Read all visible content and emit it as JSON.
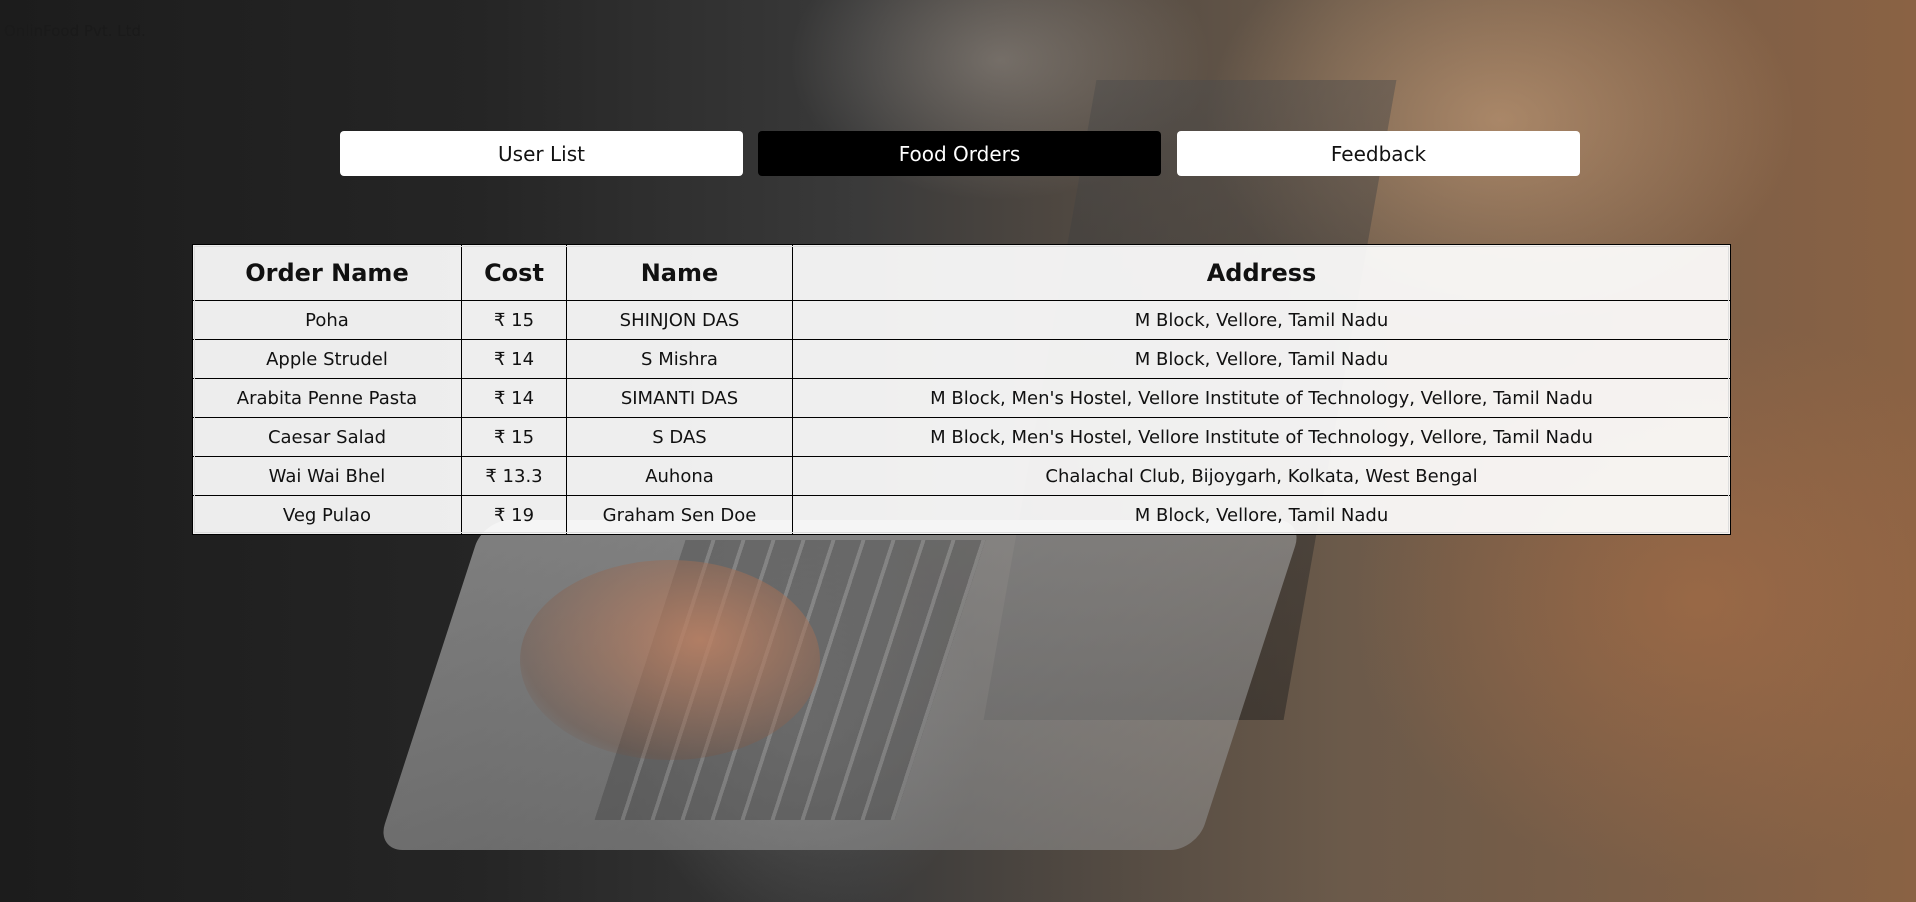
{
  "company": "OnlinFood Pvt. Ltd.",
  "tabs": [
    {
      "label": "User List",
      "active": false
    },
    {
      "label": "Food Orders",
      "active": true
    },
    {
      "label": "Feedback",
      "active": false
    }
  ],
  "table": {
    "headers": [
      "Order Name",
      "Cost",
      "Name",
      "Address"
    ],
    "rows": [
      [
        "Poha",
        "₹ 15",
        "SHINJON DAS",
        "M Block, Vellore, Tamil Nadu"
      ],
      [
        "Apple Strudel",
        "₹ 14",
        "S Mishra",
        "M Block, Vellore, Tamil Nadu"
      ],
      [
        "Arabita Penne Pasta",
        "₹ 14",
        "SIMANTI DAS",
        "M Block, Men's Hostel, Vellore Institute of Technology, Vellore, Tamil Nadu"
      ],
      [
        "Caesar Salad",
        "₹ 15",
        "S DAS",
        "M Block, Men's Hostel, Vellore Institute of Technology, Vellore, Tamil Nadu"
      ],
      [
        "Wai Wai Bhel",
        "₹ 13.3",
        "Auhona",
        "Chalachal Club, Bijoygarh, Kolkata, West Bengal"
      ],
      [
        "Veg Pulao",
        "₹ 19",
        "Graham Sen Doe",
        "M Block, Vellore, Tamil Nadu"
      ]
    ]
  },
  "colors": {
    "active_tab_bg": "#000000",
    "inactive_tab_bg": "#ffffff"
  }
}
